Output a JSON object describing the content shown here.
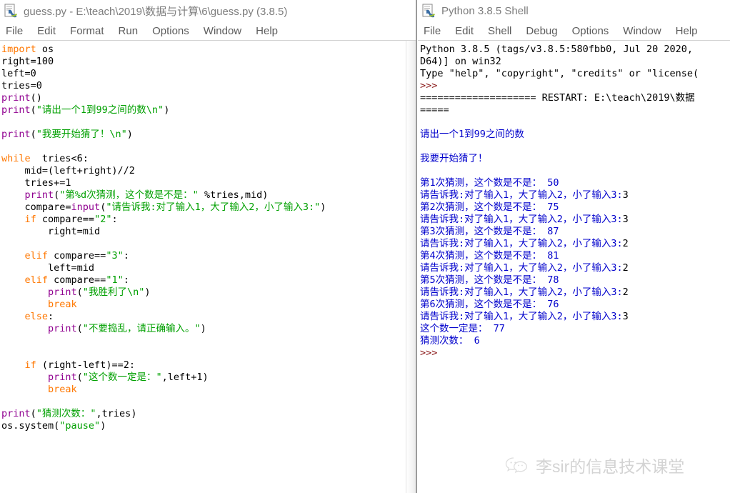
{
  "editor": {
    "title": "guess.py - E:\\teach\\2019\\数据与计算\\6\\guess.py (3.8.5)",
    "icon": "python-file-icon",
    "menus": [
      "File",
      "Edit",
      "Format",
      "Run",
      "Options",
      "Window",
      "Help"
    ],
    "code_lines": [
      [
        [
          "kw",
          "import"
        ],
        [
          "tx",
          " os"
        ]
      ],
      [
        [
          "tx",
          "right=100"
        ]
      ],
      [
        [
          "tx",
          "left=0"
        ]
      ],
      [
        [
          "tx",
          "tries=0"
        ]
      ],
      [
        [
          "bi",
          "print"
        ],
        [
          "tx",
          "()"
        ]
      ],
      [
        [
          "bi",
          "print"
        ],
        [
          "tx",
          "("
        ],
        [
          "str",
          "\"请出一个1到99之间的数\\n\""
        ],
        [
          "tx",
          ")"
        ]
      ],
      [],
      [
        [
          "bi",
          "print"
        ],
        [
          "tx",
          "("
        ],
        [
          "str",
          "\"我要开始猜了！\\n\""
        ],
        [
          "tx",
          ")"
        ]
      ],
      [],
      [
        [
          "kw",
          "while"
        ],
        [
          "tx",
          "  tries<6:"
        ]
      ],
      [
        [
          "tx",
          "    mid=(left+right)//2"
        ]
      ],
      [
        [
          "tx",
          "    tries+=1"
        ]
      ],
      [
        [
          "tx",
          "    "
        ],
        [
          "bi",
          "print"
        ],
        [
          "tx",
          "("
        ],
        [
          "str",
          "\"第%d次猜测，这个数是不是：\""
        ],
        [
          "tx",
          " %tries,mid)"
        ]
      ],
      [
        [
          "tx",
          "    compare="
        ],
        [
          "bi",
          "input"
        ],
        [
          "tx",
          "("
        ],
        [
          "str",
          "\"请告诉我:对了输入1，大了输入2，小了输入3:\""
        ],
        [
          "tx",
          ")"
        ]
      ],
      [
        [
          "tx",
          "    "
        ],
        [
          "kw",
          "if"
        ],
        [
          "tx",
          " compare=="
        ],
        [
          "str",
          "\"2\""
        ],
        [
          "tx",
          ":"
        ]
      ],
      [
        [
          "tx",
          "        right=mid"
        ]
      ],
      [],
      [
        [
          "tx",
          "    "
        ],
        [
          "kw",
          "elif"
        ],
        [
          "tx",
          " compare=="
        ],
        [
          "str",
          "\"3\""
        ],
        [
          "tx",
          ":"
        ]
      ],
      [
        [
          "tx",
          "        left=mid"
        ]
      ],
      [
        [
          "tx",
          "    "
        ],
        [
          "kw",
          "elif"
        ],
        [
          "tx",
          " compare=="
        ],
        [
          "str",
          "\"1\""
        ],
        [
          "tx",
          ":"
        ]
      ],
      [
        [
          "tx",
          "        "
        ],
        [
          "bi",
          "print"
        ],
        [
          "tx",
          "("
        ],
        [
          "str",
          "\"我胜利了\\n\""
        ],
        [
          "tx",
          ")"
        ]
      ],
      [
        [
          "tx",
          "        "
        ],
        [
          "kw",
          "break"
        ]
      ],
      [
        [
          "tx",
          "    "
        ],
        [
          "kw",
          "else"
        ],
        [
          "tx",
          ":"
        ]
      ],
      [
        [
          "tx",
          "        "
        ],
        [
          "bi",
          "print"
        ],
        [
          "tx",
          "("
        ],
        [
          "str",
          "\"不要捣乱，请正确输入。\""
        ],
        [
          "tx",
          ")"
        ]
      ],
      [],
      [],
      [
        [
          "tx",
          "    "
        ],
        [
          "kw",
          "if"
        ],
        [
          "tx",
          " (right-left)==2:"
        ]
      ],
      [
        [
          "tx",
          "        "
        ],
        [
          "bi",
          "print"
        ],
        [
          "tx",
          "("
        ],
        [
          "str",
          "\"这个数一定是：\""
        ],
        [
          "tx",
          ",left+1)"
        ]
      ],
      [
        [
          "tx",
          "        "
        ],
        [
          "kw",
          "break"
        ]
      ],
      [],
      [
        [
          "bi",
          "print"
        ],
        [
          "tx",
          "("
        ],
        [
          "str",
          "\"猜测次数：\""
        ],
        [
          "tx",
          ",tries)"
        ]
      ],
      [
        [
          "tx",
          "os.system("
        ],
        [
          "str",
          "\"pause\""
        ],
        [
          "tx",
          ")"
        ]
      ]
    ]
  },
  "shell": {
    "title": "Python 3.8.5 Shell",
    "icon": "python-shell-icon",
    "menus": [
      "File",
      "Edit",
      "Shell",
      "Debug",
      "Options",
      "Window",
      "Help"
    ],
    "lines": [
      [
        [
          "s-out",
          "Python 3.8.5 (tags/v3.8.5:580fbb0, Jul 20 2020,"
        ]
      ],
      [
        [
          "s-out",
          "D64)] on win32"
        ]
      ],
      [
        [
          "s-out",
          "Type \"help\", \"copyright\", \"credits\" or \"license("
        ]
      ],
      [
        [
          "s-prompt",
          ">>>"
        ]
      ],
      [
        [
          "s-out",
          "==================== RESTART: E:\\teach\\2019\\数据"
        ]
      ],
      [
        [
          "s-out",
          "====="
        ]
      ],
      [],
      [
        [
          "s-blue",
          "请出一个1到99之间的数"
        ]
      ],
      [],
      [
        [
          "s-blue",
          "我要开始猜了！"
        ]
      ],
      [],
      [
        [
          "s-blue",
          "第1次猜测，这个数是不是： 50"
        ]
      ],
      [
        [
          "s-blue",
          "请告诉我:对了输入1，大了输入2，小了输入3:"
        ],
        [
          "s-in",
          "3"
        ]
      ],
      [
        [
          "s-blue",
          "第2次猜测，这个数是不是： 75"
        ]
      ],
      [
        [
          "s-blue",
          "请告诉我:对了输入1，大了输入2，小了输入3:"
        ],
        [
          "s-in",
          "3"
        ]
      ],
      [
        [
          "s-blue",
          "第3次猜测，这个数是不是： 87"
        ]
      ],
      [
        [
          "s-blue",
          "请告诉我:对了输入1，大了输入2，小了输入3:"
        ],
        [
          "s-in",
          "2"
        ]
      ],
      [
        [
          "s-blue",
          "第4次猜测，这个数是不是： 81"
        ]
      ],
      [
        [
          "s-blue",
          "请告诉我:对了输入1，大了输入2，小了输入3:"
        ],
        [
          "s-in",
          "2"
        ]
      ],
      [
        [
          "s-blue",
          "第5次猜测，这个数是不是： 78"
        ]
      ],
      [
        [
          "s-blue",
          "请告诉我:对了输入1，大了输入2，小了输入3:"
        ],
        [
          "s-in",
          "2"
        ]
      ],
      [
        [
          "s-blue",
          "第6次猜测，这个数是不是： 76"
        ]
      ],
      [
        [
          "s-blue",
          "请告诉我:对了输入1，大了输入2，小了输入3:"
        ],
        [
          "s-in",
          "3"
        ]
      ],
      [
        [
          "s-blue",
          "这个数一定是： 77"
        ]
      ],
      [
        [
          "s-blue",
          "猜测次数： 6"
        ]
      ],
      [
        [
          "s-prompt",
          ">>>"
        ]
      ]
    ]
  },
  "watermark": {
    "icon": "wechat-icon",
    "text": "李sir的信息技术课堂"
  },
  "colors": {
    "keyword": "#ff7700",
    "builtin": "#900090",
    "string": "#00a000",
    "shell_output": "#0000cc",
    "shell_prompt": "#8b1a1a",
    "titlebar_text": "#7d7d7d"
  }
}
